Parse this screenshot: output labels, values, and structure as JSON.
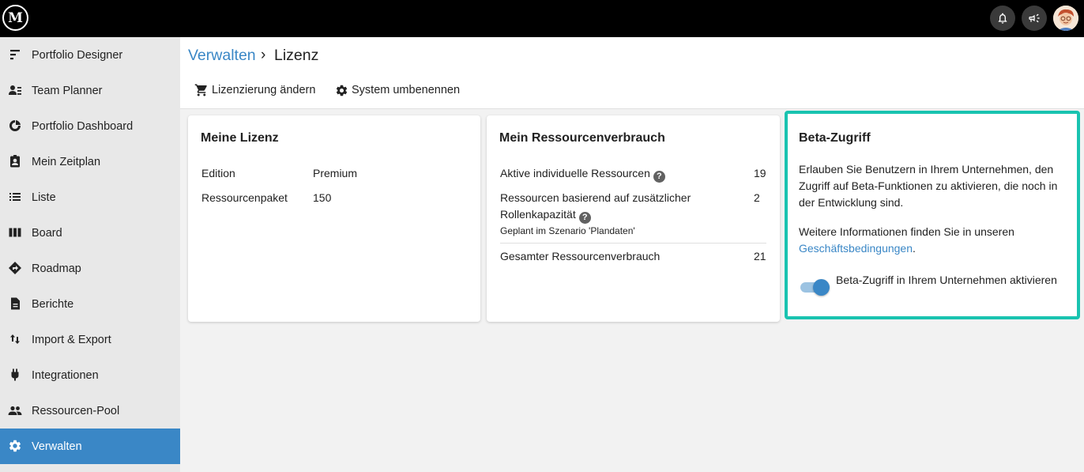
{
  "app": {
    "logo_text": "M",
    "notifications_icon": "bell-icon",
    "announcements_icon": "megaphone-icon",
    "avatar_icon": "user-avatar"
  },
  "sidebar": {
    "items": [
      {
        "label": "Portfolio Designer",
        "icon": "portfolio-designer-icon"
      },
      {
        "label": "Team Planner",
        "icon": "team-planner-icon"
      },
      {
        "label": "Portfolio Dashboard",
        "icon": "dashboard-icon"
      },
      {
        "label": "Mein Zeitplan",
        "icon": "schedule-icon"
      },
      {
        "label": "Liste",
        "icon": "list-icon"
      },
      {
        "label": "Board",
        "icon": "board-icon"
      },
      {
        "label": "Roadmap",
        "icon": "roadmap-icon"
      },
      {
        "label": "Berichte",
        "icon": "report-icon"
      },
      {
        "label": "Import & Export",
        "icon": "import-export-icon"
      },
      {
        "label": "Integrationen",
        "icon": "plug-icon"
      },
      {
        "label": "Ressourcen-Pool",
        "icon": "people-icon"
      },
      {
        "label": "Verwalten",
        "icon": "gear-icon",
        "active": true
      }
    ]
  },
  "breadcrumb": {
    "parent": "Verwalten",
    "separator": "›",
    "current": "Lizenz"
  },
  "actions": {
    "change_license": "Lizenzierung ändern",
    "rename_system": "System umbenennen"
  },
  "license_card": {
    "title": "Meine Lizenz",
    "rows": [
      {
        "label": "Edition",
        "value": "Premium"
      },
      {
        "label": "Ressourcenpaket",
        "value": "150"
      }
    ]
  },
  "usage_card": {
    "title": "Mein Ressourcenverbrauch",
    "active_label": "Aktive individuelle Ressourcen",
    "active_value": "19",
    "role_label_1": "Ressourcen basierend auf zusätzlicher",
    "role_label_2": "Rollenkapazität",
    "role_value": "2",
    "role_note": "Geplant im Szenario 'Plandaten'",
    "total_label": "Gesamter Ressourcenverbrauch",
    "total_value": "21"
  },
  "beta_card": {
    "title": "Beta-Zugriff",
    "description": "Erlauben Sie Benutzern in Ihrem Unternehmen, den Zugriff auf Beta-Funktionen zu aktivieren, die noch in der Entwicklung sind.",
    "info_prefix": "Weitere Informationen finden Sie in unseren",
    "info_link": "Geschäftsbedingungen",
    "info_suffix": ".",
    "toggle_label": "Beta-Zugriff in Ihrem Unternehmen aktivieren",
    "toggle_on": true
  },
  "colors": {
    "accent": "#3a87c6",
    "highlight_border": "#19c3b0",
    "topbar": "#000000",
    "sidebar": "#e8e8e8"
  }
}
